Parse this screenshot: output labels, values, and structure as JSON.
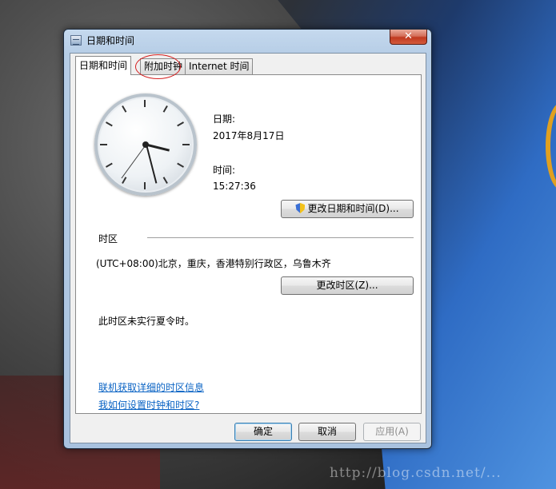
{
  "window": {
    "title": "日期和时间",
    "close_glyph": "✕"
  },
  "tabs": [
    {
      "label": "日期和时间",
      "active": true
    },
    {
      "label": "附加时钟",
      "active": false
    },
    {
      "label": "Internet 时间",
      "active": false
    }
  ],
  "date_time": {
    "date_label": "日期:",
    "date_value": "2017年8月17日",
    "time_label": "时间:",
    "time_value": "15:27:36",
    "change_button": "更改日期和时间(D)..."
  },
  "timezone": {
    "section_label": "时区",
    "value": "(UTC+08:00)北京，重庆，香港特别行政区，乌鲁木齐",
    "change_button": "更改时区(Z)...",
    "dst_note": "此时区未实行夏令时。"
  },
  "links": {
    "online_info": "联机获取详细的时区信息",
    "how_to": "我如何设置时钟和时区?"
  },
  "footer": {
    "ok": "确定",
    "cancel": "取消",
    "apply": "应用(A)"
  },
  "desktop": {
    "watermark": "http://blog.csdn.net/..."
  },
  "clock": {
    "hour": 15,
    "minute": 27,
    "second": 36
  },
  "colors": {
    "link": "#0a63c4",
    "close_button": "#c0391f",
    "annotation_circle": "#d62020"
  }
}
